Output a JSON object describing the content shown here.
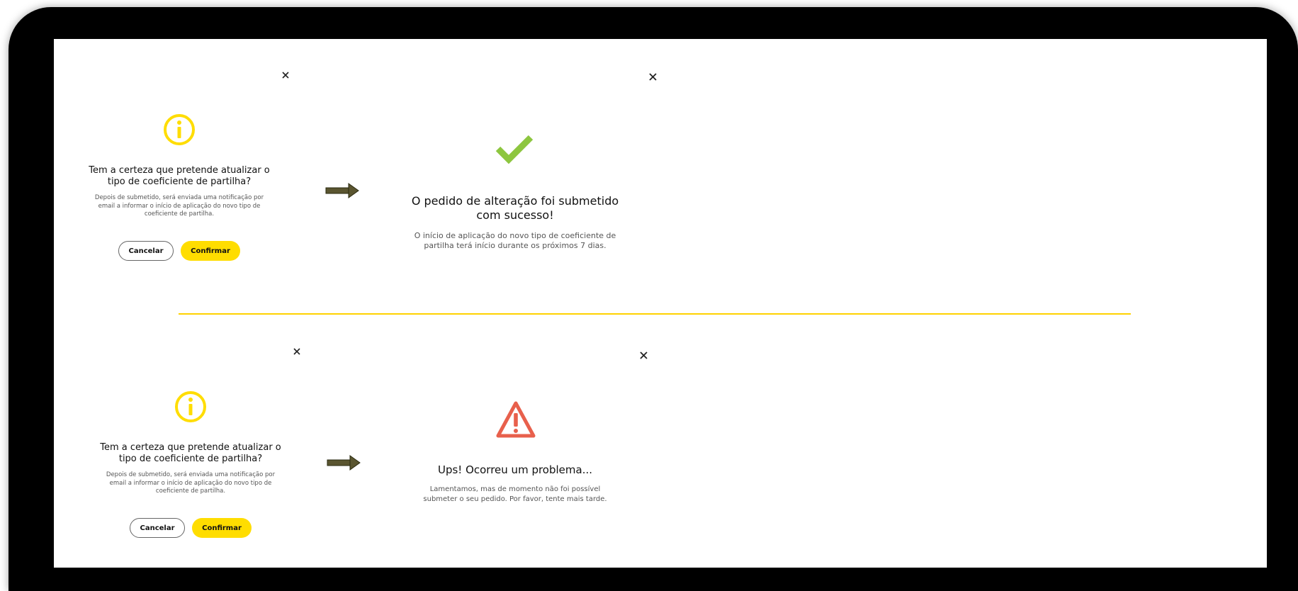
{
  "colors": {
    "accent_yellow": "#FFDD00",
    "success_green": "#8DC63F",
    "error_red": "#E8604C",
    "arrow": "#5A5530",
    "divider": "#FFD200"
  },
  "flows": [
    {
      "confirm_dialog": {
        "close_icon": "close-icon",
        "icon": "info-icon",
        "title": "Tem a certeza que pretende atualizar o tipo de coeficiente de partilha?",
        "description": "Depois de submetido, será enviada uma notificação por email a informar o início de aplicação do novo tipo de coeficiente de partilha.",
        "cancel_label": "Cancelar",
        "confirm_label": "Confirmar"
      },
      "arrow_icon": "right-arrow-icon",
      "result_dialog": {
        "close_icon": "close-icon",
        "icon": "checkmark-icon",
        "title": "O pedido de alteração foi submetido com sucesso!",
        "description": "O início de aplicação do novo tipo de coeficiente de partilha terá início durante os próximos 7 dias."
      }
    },
    {
      "confirm_dialog": {
        "close_icon": "close-icon",
        "icon": "info-icon",
        "title": "Tem a certeza que pretende atualizar o tipo de coeficiente de partilha?",
        "description": "Depois de submetido, será enviada uma notificação por email a informar o início de aplicação do novo tipo de coeficiente de partilha.",
        "cancel_label": "Cancelar",
        "confirm_label": "Confirmar"
      },
      "arrow_icon": "right-arrow-icon",
      "result_dialog": {
        "close_icon": "close-icon",
        "icon": "warning-icon",
        "title": "Ups! Ocorreu um problema...",
        "description": "Lamentamos, mas de momento não foi possível submeter o seu pedido. Por favor, tente mais tarde."
      }
    }
  ]
}
